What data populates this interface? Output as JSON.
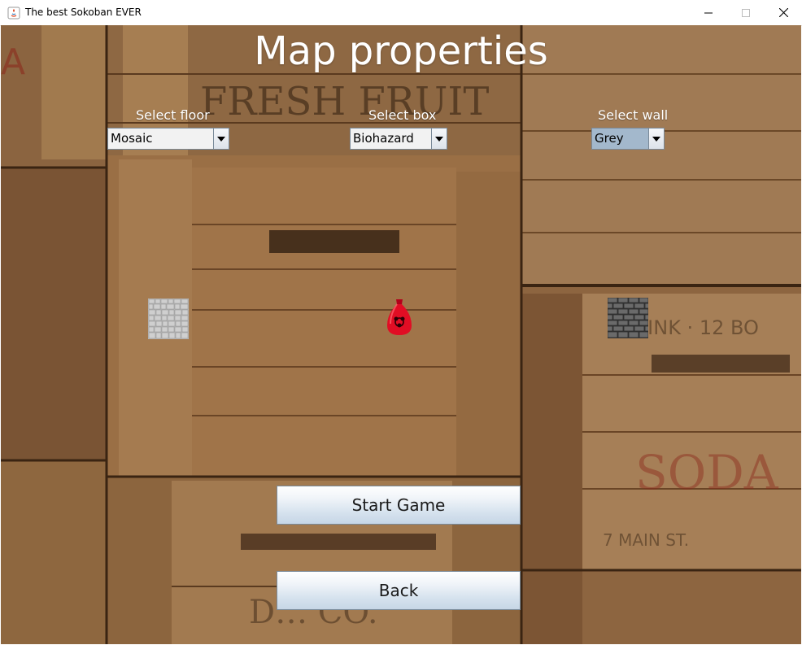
{
  "window": {
    "title": "The best Sokoban EVER",
    "controls": {
      "minimize": "minimize-icon",
      "maximize": "maximize-icon",
      "close": "close-icon"
    }
  },
  "page": {
    "title": "Map properties"
  },
  "selectors": {
    "floor": {
      "label": "Select floor",
      "value": "Mosaic"
    },
    "box": {
      "label": "Select box",
      "value": "Biohazard"
    },
    "wall": {
      "label": "Select wall",
      "value": "Grey"
    }
  },
  "previews": {
    "floor": "floor-tile-icon",
    "box": "biohazard-box-icon",
    "wall": "brick-wall-icon"
  },
  "buttons": {
    "start": "Start Game",
    "back": "Back"
  },
  "colors": {
    "combo_focused": "#a3b8cc",
    "button_gradient_top": "#ffffff",
    "button_gradient_bottom": "#c6d6e6"
  }
}
